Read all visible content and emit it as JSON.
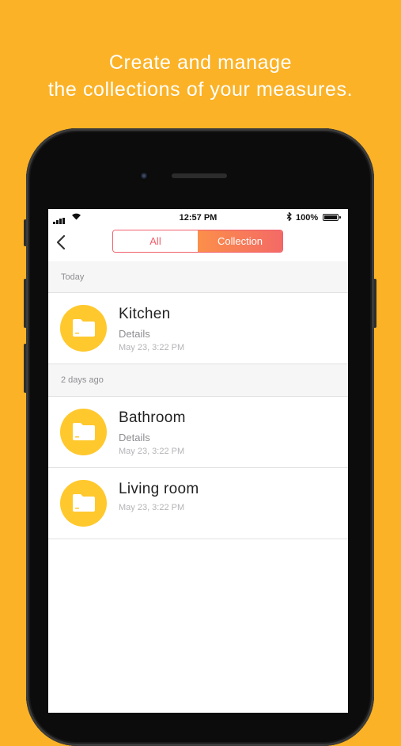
{
  "headline": {
    "line1": "Create and manage",
    "line2": "the collections of your measures."
  },
  "status_bar": {
    "time": "12:57 PM",
    "battery": "100%"
  },
  "nav": {
    "segments": [
      {
        "label": "All",
        "selected": false
      },
      {
        "label": "Collection",
        "selected": true
      }
    ]
  },
  "sections": [
    {
      "header": "Today",
      "items": [
        {
          "title": "Kitchen",
          "details": "Details",
          "date": "May 23, 3:22 PM"
        }
      ]
    },
    {
      "header": "2 days ago",
      "items": [
        {
          "title": "Bathroom",
          "details": "Details",
          "date": "May 23, 3:22 PM"
        },
        {
          "title": "Living room",
          "details": "",
          "date": "May 23, 3:22 PM"
        }
      ]
    }
  ],
  "colors": {
    "background": "#fbb226",
    "folder_circle": "#ffc82d",
    "accent": "#f0606c"
  }
}
